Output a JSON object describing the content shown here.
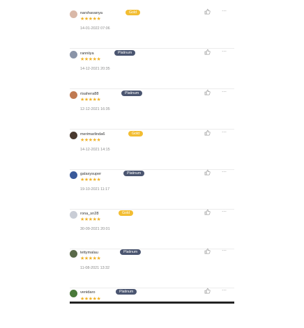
{
  "reviews": [
    {
      "username": "narshavanya",
      "tier": "Gold",
      "tier_color": "#f2bd32",
      "rating": 5,
      "stars": "★★★★★",
      "date": "14-01-2022 07:06",
      "avatar_color": "#d9b8a8"
    },
    {
      "username": "ranniiya",
      "tier": "Platinum",
      "tier_color": "#4a5570",
      "rating": 5,
      "stars": "★★★★★",
      "date": "14-12-2021 20:35",
      "avatar_color": "#8a94a8"
    },
    {
      "username": "risahera88",
      "tier": "Platinum",
      "tier_color": "#4a5570",
      "rating": 5,
      "stars": "★★★★★",
      "date": "12-12-2021 16:35",
      "avatar_color": "#c07a52"
    },
    {
      "username": "merimarlinda6",
      "tier": "Gold",
      "tier_color": "#f2bd32",
      "rating": 5,
      "stars": "★★★★★",
      "date": "14-12-2021 14:15",
      "avatar_color": "#4a3a30"
    },
    {
      "username": "galaxysuper",
      "tier": "Platinum",
      "tier_color": "#4a5570",
      "rating": 5,
      "stars": "★★★★★",
      "date": "19-10-2021 11:17",
      "avatar_color": "#3a5a9a"
    },
    {
      "username": "rona_sn28",
      "tier": "Gold",
      "tier_color": "#f2bd32",
      "rating": 5,
      "stars": "★★★★★",
      "date": "30-09-2021 20:01",
      "avatar_color": "#c9cdd6"
    },
    {
      "username": "tettymalau",
      "tier": "Platinum",
      "tier_color": "#4a5570",
      "rating": 5,
      "stars": "★★★★★",
      "date": "11-08-2021 13:32",
      "avatar_color": "#5a6a4a"
    },
    {
      "username": "venidaro",
      "tier": "Platinum",
      "tier_color": "#4a5570",
      "rating": 5,
      "stars": "★★★★★",
      "date": "",
      "avatar_color": "#4a7a3a"
    }
  ],
  "icons": {
    "like": "thumbs-up-icon",
    "more": "more-options-icon"
  },
  "colors": {
    "star": "#f0b226",
    "date": "#8a8a8a",
    "divider": "#ececec"
  }
}
